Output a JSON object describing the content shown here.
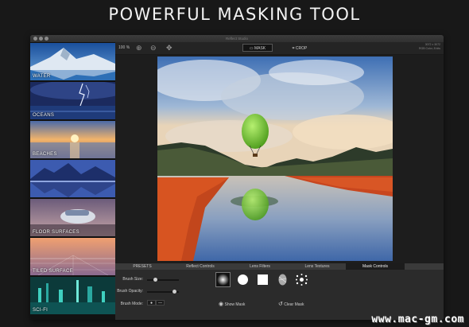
{
  "headline": "POWERFUL MASKING TOOL",
  "window": {
    "title": "Reflect Studio"
  },
  "sidebar": {
    "items": [
      {
        "label": "WATER",
        "icon": "mountain-lake-thumbnail"
      },
      {
        "label": "OCEANS",
        "icon": "lightning-ocean-thumbnail"
      },
      {
        "label": "BEACHES",
        "icon": "sunset-beach-thumbnail"
      },
      {
        "label": "",
        "icon": "mountain-reflection-thumbnail"
      },
      {
        "label": "FLOOR SURFACES",
        "icon": "car-floor-thumbnail"
      },
      {
        "label": "TILED SURFACE",
        "icon": "tiled-floor-thumbnail"
      },
      {
        "label": "SCI-FI",
        "icon": "scifi-city-thumbnail"
      }
    ]
  },
  "toolbar": {
    "zoom": "100 %",
    "mask_label": "MASK",
    "crop_label": "CROP",
    "info_line1": "3072 x 3072",
    "info_line2": "RGB Color, 8 bits"
  },
  "tabs": [
    "PRESETS",
    "Reflect Controls",
    "Lens Filters",
    "Lens Textures",
    "Mask Controls"
  ],
  "active_tab": "Mask Controls",
  "mask_controls": {
    "brush_size_label": "Brush Size:",
    "brush_opacity_label": "Brush Opacity:",
    "brush_mode_label": "Brush Mode:",
    "brush_size_value": 0.25,
    "brush_opacity_value": 0.85,
    "mode_paint": "●",
    "mode_erase": "—",
    "show_mask_label": "Show Mask",
    "clear_mask_label": "Clear Mask"
  },
  "watermark": "www.mac-gm.com"
}
